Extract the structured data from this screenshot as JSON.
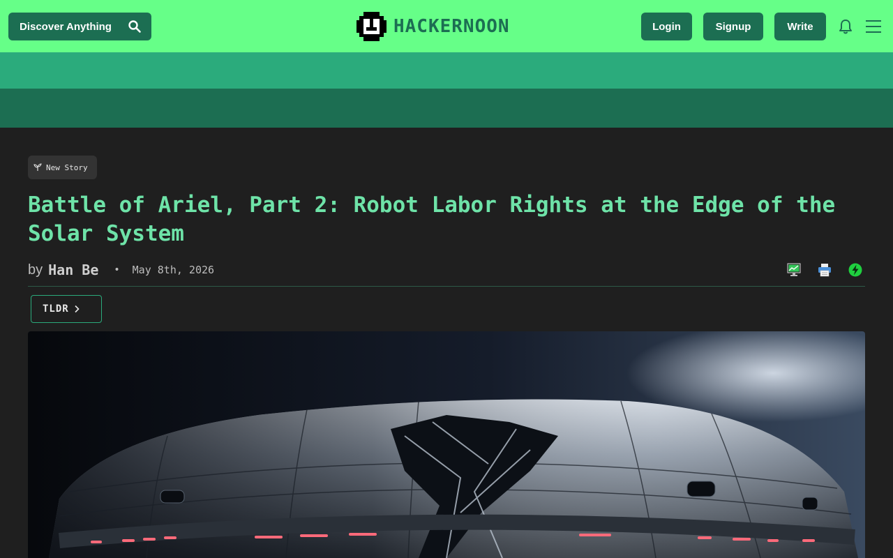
{
  "header": {
    "discover_label": "Discover Anything",
    "logo_text": "HACKERNOON",
    "login_label": "Login",
    "signup_label": "Signup",
    "write_label": "Write"
  },
  "article": {
    "tag": "New Story",
    "title": "Battle of Ariel, Part 2: Robot Labor Rights at the Edge of the Solar System",
    "by": "by",
    "author": "Han Be",
    "separator": "•",
    "date": "May 8th, 2026",
    "tldr_label": "TLDR"
  },
  "icons": [
    "search-icon",
    "hackernoon-logo-icon",
    "bell-icon",
    "hamburger-menu-icon",
    "sprout-icon",
    "monitor-icon",
    "printer-icon",
    "lightning-icon",
    "chevron-right-icon"
  ],
  "colors": {
    "header_bg": "#66ff88",
    "brand_dark": "#1c6e52",
    "brand_mid": "#2bab7c",
    "title_green": "#6ee3a8",
    "page_bg": "#1f1f1f"
  }
}
